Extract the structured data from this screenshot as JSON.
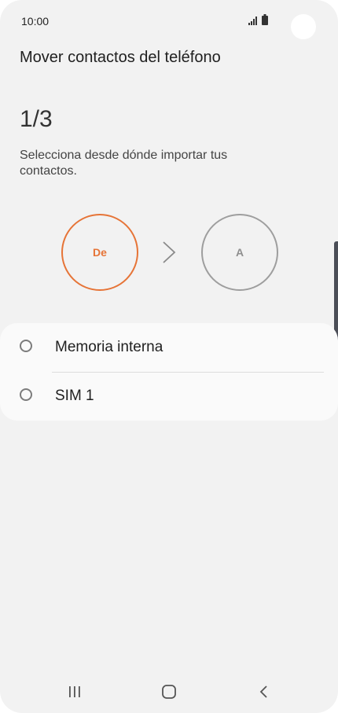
{
  "status_bar": {
    "time": "10:00",
    "icons": [
      "signal-icon",
      "battery-icon"
    ]
  },
  "page": {
    "title": "Mover contactos del teléfono",
    "step": "1/3",
    "instructions": "Selecciona desde dónde importar tus contactos."
  },
  "flow": {
    "from_label": "De",
    "to_label": "A",
    "arrow_icon": "chevron-right-icon",
    "active_color": "#e67437",
    "inactive_color": "#9e9e9e"
  },
  "options": [
    {
      "label": "Memoria interna",
      "selected": false
    },
    {
      "label": "SIM 1",
      "selected": false
    }
  ],
  "nav_bar": {
    "buttons": [
      "recents-icon",
      "home-icon",
      "back-icon"
    ]
  }
}
